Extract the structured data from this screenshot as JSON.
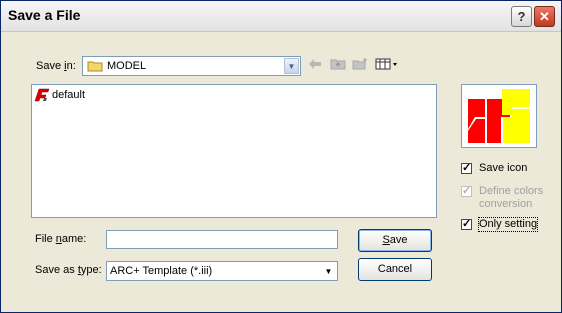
{
  "window": {
    "title": "Save a File",
    "help_label": "?",
    "close_label": "✕"
  },
  "lookin": {
    "label_pre": "Save ",
    "label_acc": "i",
    "label_post": "n:",
    "value": "MODEL"
  },
  "toolbar": {
    "back_icon": "back-arrow-icon",
    "up_icon": "up-folder-icon",
    "new_icon": "new-folder-icon",
    "view_icon": "view-menu-icon"
  },
  "files": [
    {
      "name": "default",
      "icon": "arc-template-icon"
    }
  ],
  "options": {
    "save_icon": {
      "label": "Save icon",
      "checked": true,
      "enabled": true
    },
    "define_colors": {
      "label_line1": "Define colors",
      "label_line2": "conversion",
      "checked": true,
      "enabled": false
    },
    "only_setting": {
      "label": "Only setting",
      "checked": true,
      "enabled": true
    }
  },
  "filename": {
    "label_pre": "File ",
    "label_acc": "n",
    "label_post": "ame:",
    "value": ""
  },
  "filetype": {
    "label_pre": "Save as ",
    "label_acc": "t",
    "label_post": "ype:",
    "value": "ARC+ Template (*.iii)"
  },
  "buttons": {
    "save_acc": "S",
    "save_rest": "ave",
    "cancel": "Cancel"
  },
  "colors": {
    "accent_red": "#ff0000",
    "accent_yellow": "#ffff00",
    "folder": "#f5d66b"
  }
}
